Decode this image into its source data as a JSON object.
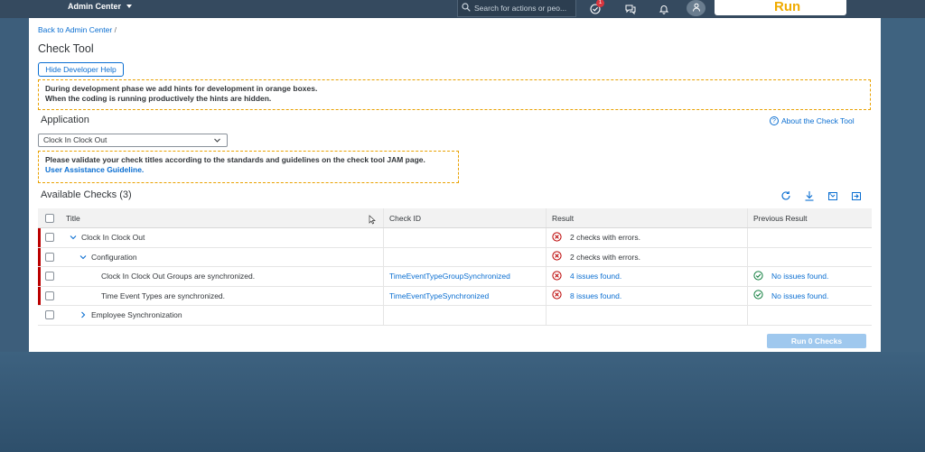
{
  "shell": {
    "title": "Admin Center",
    "search_placeholder": "Search for actions or peo...",
    "notification_count": "1",
    "run_label": "Run"
  },
  "breadcrumb": {
    "link": "Back to Admin Center",
    "separator": "/"
  },
  "page": {
    "title": "Check Tool",
    "help_button": "Hide Developer Help",
    "hint1_line1": "During development phase we add hints for development in orange boxes.",
    "hint1_line2": "When the coding is running productively the hints are hidden.",
    "application_label": "Application",
    "about_link": "About the Check Tool",
    "application_select": "Clock In Clock Out",
    "hint2_line1": "Please validate your check titles according to the standards and guidelines on the check tool JAM page.",
    "hint2_link": "User Assistance Guideline.",
    "available_checks": "Available Checks (3)",
    "run_button": "Run 0 Checks"
  },
  "table": {
    "headers": {
      "title": "Title",
      "check_id": "Check ID",
      "result": "Result",
      "previous_result": "Previous Result"
    },
    "rows": [
      {
        "title": "Clock In Clock Out",
        "check_id": "",
        "result": "2 checks with errors.",
        "previous": ""
      },
      {
        "title": "Configuration",
        "check_id": "",
        "result": "2 checks with errors.",
        "previous": ""
      },
      {
        "title": "Clock In Clock Out Groups are synchronized.",
        "check_id": "TimeEventTypeGroupSynchronized",
        "result": "4 issues found.",
        "previous": "No issues found."
      },
      {
        "title": "Time Event Types are synchronized.",
        "check_id": "TimeEventTypeSynchronized",
        "result": "8 issues found.",
        "previous": "No issues found."
      },
      {
        "title": "Employee Synchronization",
        "check_id": "",
        "result": "",
        "previous": ""
      }
    ]
  },
  "colors": {
    "shell": "#354a5f",
    "link": "#0a6ed1",
    "error": "#bb0000",
    "success": "#107e3e",
    "hint_border": "#e9a100",
    "run_logo": "#f0ab00"
  },
  "icons": {
    "search": "search-icon",
    "notifications": "bell-icon",
    "user": "person-icon",
    "tasks": "task-check-icon",
    "feedback": "feedback-icon",
    "refresh": "refresh-icon",
    "download": "download-icon",
    "export": "export-icon",
    "import": "import-icon"
  }
}
